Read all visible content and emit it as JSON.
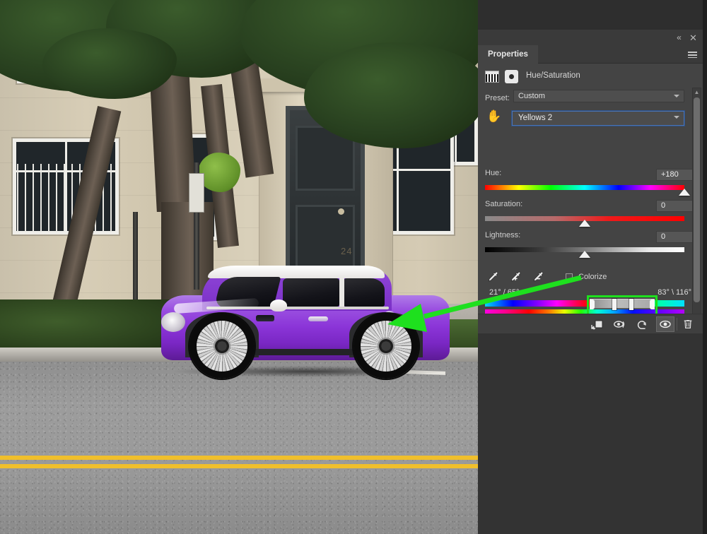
{
  "app": {
    "background_color": "#333333",
    "panel_background": "#444444",
    "accent_focus": "#4a74b5",
    "annotation_color": "#1ee01e"
  },
  "panel": {
    "titlebar": {
      "collapse_icon": "double-chevron-left-icon",
      "collapse_glyph": "«",
      "close_icon": "close-icon",
      "close_glyph": "✕"
    },
    "tab": {
      "label": "Properties",
      "menu_icon": "hamburger-menu-icon"
    },
    "adjustment": {
      "title": "Hue/Saturation",
      "thumbnail_icon": "gradient-thumbnail-icon",
      "type_icon": "hue-saturation-badge-icon"
    },
    "preset": {
      "label": "Preset:",
      "value": "Custom",
      "caret_icon": "chevron-down-icon"
    },
    "range": {
      "hand_tool_icon": "on-image-adjustment-hand-icon",
      "hand_glyph": "✋",
      "value": "Yellows 2",
      "caret_icon": "chevron-down-icon"
    },
    "sliders": [
      {
        "label": "Hue:",
        "value": "+180",
        "thumb_pct": 100,
        "track": "hue-spectrum"
      },
      {
        "label": "Saturation:",
        "value": "0",
        "thumb_pct": 50,
        "track": "saturation-gradient"
      },
      {
        "label": "Lightness:",
        "value": "0",
        "thumb_pct": 50,
        "track": "lightness-gradient"
      }
    ],
    "tools": {
      "eyedropper_icon": "eyedropper-icon",
      "eyedropper_add_icon": "eyedropper-plus-icon",
      "eyedropper_subtract_icon": "eyedropper-minus-icon",
      "colorize_label": "Colorize",
      "colorize_checked": false
    },
    "color_range": {
      "left_label": "21° / 65°",
      "right_label": "83° \\ 116°",
      "highlighted": true,
      "stops": [
        "range-falloff-left",
        "range-edge-left",
        "range-edge-right",
        "range-falloff-right"
      ]
    },
    "scrollbar": {
      "up_icon": "chevron-up-icon",
      "up_glyph": "▲",
      "down_icon": "chevron-down-icon",
      "down_glyph": "▼"
    },
    "footer_buttons": [
      {
        "name": "clip-to-layer-button",
        "icon": "clip-to-layer-icon",
        "active": false
      },
      {
        "name": "toggle-last-state-button",
        "icon": "eye-with-arrow-icon",
        "active": false
      },
      {
        "name": "reset-button",
        "icon": "reset-arrow-icon",
        "active": false
      },
      {
        "name": "toggle-visibility-button",
        "icon": "eye-icon",
        "active": true
      },
      {
        "name": "delete-layer-button",
        "icon": "trash-icon",
        "active": false
      }
    ]
  },
  "photo": {
    "description": "Street scene with a purple Mini Cooper parked in front of a stone building and a large tree",
    "door_number": "24",
    "annotation": {
      "type": "arrow",
      "from": "color-range-slider",
      "to": "car-rear-fender",
      "color": "#1ee01e"
    }
  }
}
